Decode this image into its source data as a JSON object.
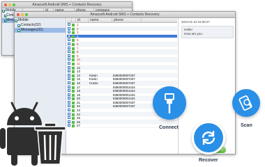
{
  "back_window": {
    "title": "Amacsoft Android SMS + Contacts Recovery",
    "tree": [
      "Mobile",
      "Contacts(32)",
      "Messages(32)"
    ],
    "columns": [
      "id",
      "name",
      "phone",
      "company"
    ]
  },
  "front_window": {
    "title": "Amacsoft Android SMS + Contacts Recovery",
    "tree": [
      "Mobile",
      "Contacts(32)",
      "Messages(32)"
    ],
    "columns": [
      "id",
      "name",
      "phone"
    ],
    "rows": [
      {
        "id": "1",
        "name": "",
        "phone": "",
        "red": true
      },
      {
        "id": "2",
        "name": "",
        "phone": "",
        "red": true
      },
      {
        "id": "3",
        "name": "",
        "phone": "",
        "red": true
      },
      {
        "id": "4",
        "name": "",
        "phone": "",
        "red": false,
        "hl": true
      },
      {
        "id": "5",
        "name": "",
        "phone": "",
        "red": true
      },
      {
        "id": "6",
        "name": "",
        "phone": "",
        "red": true
      },
      {
        "id": "7",
        "name": "",
        "phone": "",
        "red": true
      },
      {
        "id": "8",
        "name": "",
        "phone": "",
        "red": true
      },
      {
        "id": "9",
        "name": "",
        "phone": "",
        "red": true
      },
      {
        "id": "10",
        "name": "",
        "phone": "",
        "red": true
      },
      {
        "id": "11",
        "name": "",
        "phone": "",
        "red": true
      },
      {
        "id": "12",
        "name": "",
        "phone": "",
        "red": false
      },
      {
        "id": "13",
        "name": "",
        "phone": "",
        "red": false
      },
      {
        "id": "14",
        "name": "Kissin",
        "phone": "8360000007337",
        "red": false
      },
      {
        "id": "15",
        "name": "Kissin",
        "phone": "8360000007337",
        "red": false
      },
      {
        "id": "16",
        "name": "Crazie",
        "phone": "8360000007337",
        "red": false
      },
      {
        "id": "17",
        "name": "",
        "phone": "8360000001424",
        "red": false
      },
      {
        "id": "18",
        "name": "",
        "phone": "8360000001424",
        "red": false
      },
      {
        "id": "19",
        "name": "",
        "phone": "8360000001424",
        "red": false
      },
      {
        "id": "20",
        "name": "",
        "phone": "8360000001424",
        "red": false
      },
      {
        "id": "21",
        "name": "",
        "phone": "8360000007337",
        "red": false
      },
      {
        "id": "22",
        "name": "",
        "phone": "8360000007337",
        "red": false
      },
      {
        "id": "23",
        "name": "",
        "phone": "",
        "red": false
      },
      {
        "id": "24",
        "name": "",
        "phone": "",
        "red": false
      },
      {
        "id": "25",
        "name": "",
        "phone": "",
        "red": false
      },
      {
        "id": "26",
        "name": "",
        "phone": "",
        "red": false
      },
      {
        "id": "27",
        "name": "",
        "phone": "",
        "red": false
      }
    ],
    "message": {
      "timestamp": "2013-01-24 04:06:27",
      "lines": [
        "Hello!",
        "How are you."
      ]
    }
  },
  "actions": {
    "connect": "Connect",
    "scan": "Scan",
    "recover": "Recover",
    "recover_button": "Recovery"
  },
  "colors": {
    "accent": "#2a8fe6",
    "recover_green": "#59b93a",
    "deleted_red": "#d21e1e"
  }
}
